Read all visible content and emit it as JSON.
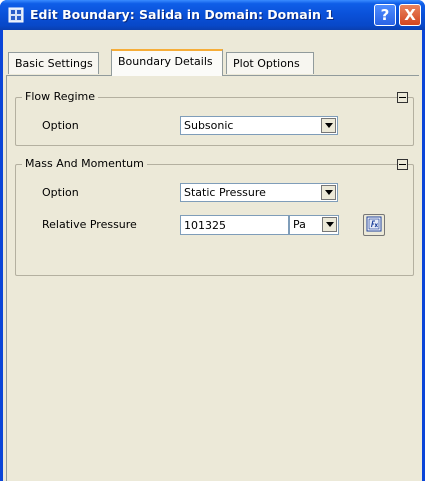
{
  "window": {
    "title": "Edit Boundary: Salida in Domain: Domain 1",
    "help_label": "?",
    "close_label": "X"
  },
  "tabs": [
    {
      "label": "Basic Settings",
      "active": false
    },
    {
      "label": "Boundary Details",
      "active": true
    },
    {
      "label": "Plot Options",
      "active": false
    }
  ],
  "flow_regime": {
    "title": "Flow Regime",
    "option_label": "Option",
    "option_value": "Subsonic"
  },
  "mass_momentum": {
    "title": "Mass And Momentum",
    "option_label": "Option",
    "option_value": "Static Pressure",
    "pressure_label": "Relative Pressure",
    "pressure_value": "101325",
    "pressure_unit": "Pa"
  },
  "colors": {
    "title_bar": "#0a50d8",
    "client_bg": "#ece9d8",
    "active_tab_accent": "#f6ad38",
    "close_button": "#d2451f"
  },
  "icons": {
    "title": "boundary-icon",
    "help": "help-icon",
    "close": "close-icon",
    "collapse": "collapse-icon",
    "dropdown": "chevron-down-icon",
    "expression": "expression-editor-icon"
  }
}
